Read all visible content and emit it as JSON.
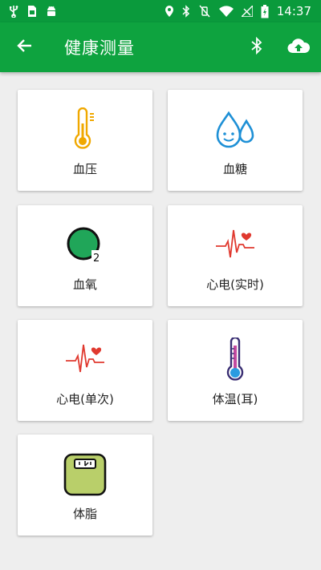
{
  "status_bar": {
    "time": "14:37",
    "icons": [
      "usb-icon",
      "sim-icon",
      "android-icon",
      "location-icon",
      "bluetooth-icon",
      "vibrate-off-icon",
      "wifi-icon",
      "signal-icon",
      "battery-charging-icon"
    ]
  },
  "app_bar": {
    "title": "健康测量",
    "back_icon": "arrow-back-icon",
    "bluetooth_icon": "bluetooth-icon",
    "upload_icon": "cloud-upload-icon"
  },
  "colors": {
    "status_bar": "#0a9a3c",
    "app_bar": "#0ea33f",
    "background": "#eeeeee",
    "card": "#ffffff"
  },
  "cards": [
    {
      "label": "血压",
      "icon": "thermometer-gauge-icon"
    },
    {
      "label": "血糖",
      "icon": "water-drops-icon"
    },
    {
      "label": "血氧",
      "icon": "o2-icon"
    },
    {
      "label": "心电(实时)",
      "icon": "ecg-heart-icon"
    },
    {
      "label": "心电(单次)",
      "icon": "ecg-heart-icon"
    },
    {
      "label": "体温(耳)",
      "icon": "thermometer-icon"
    },
    {
      "label": "体脂",
      "icon": "body-scale-icon"
    }
  ]
}
